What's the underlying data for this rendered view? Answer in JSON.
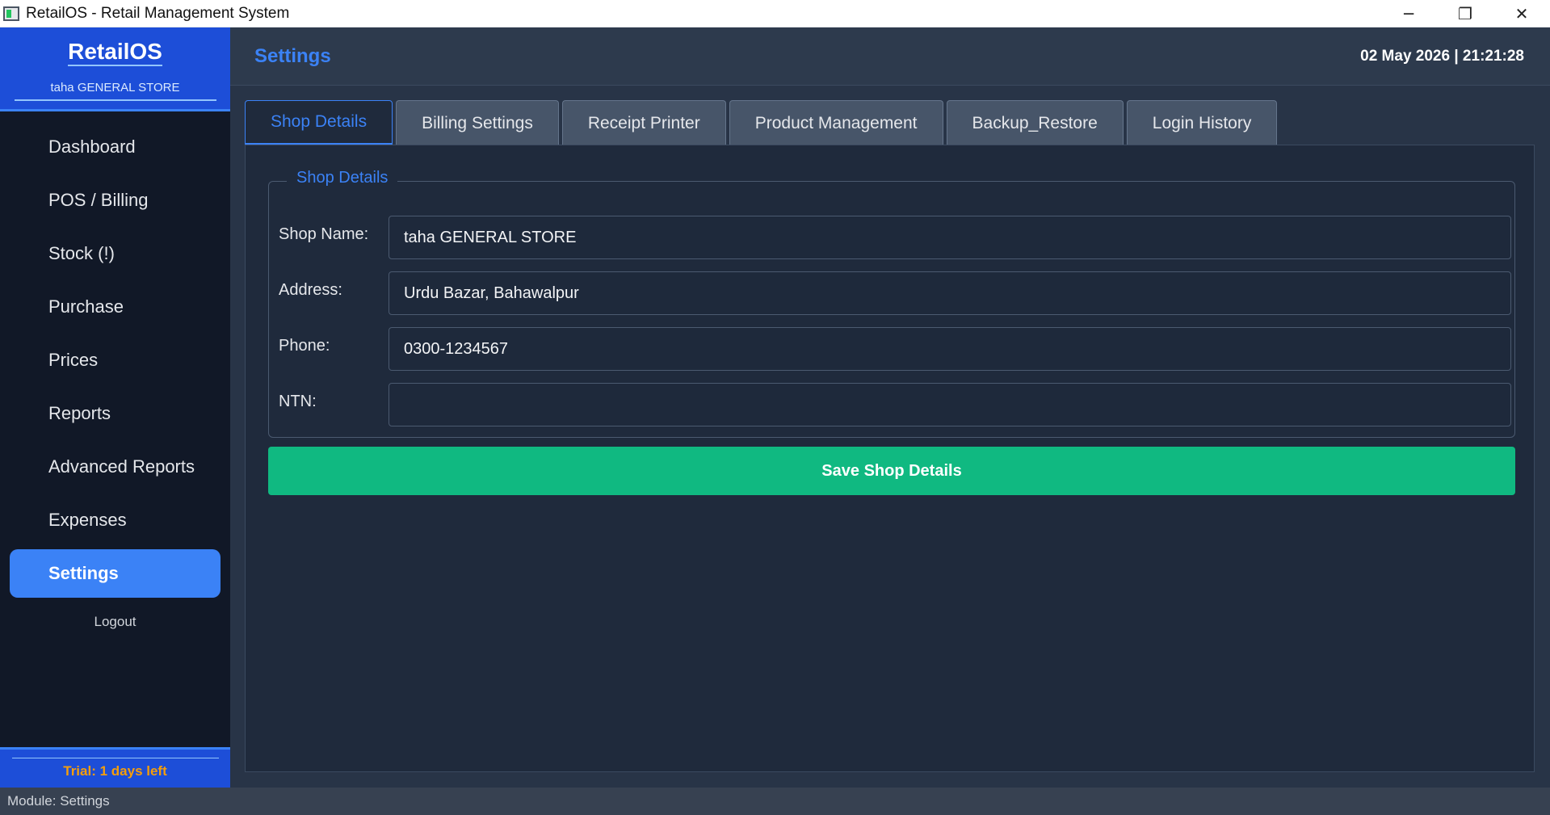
{
  "window": {
    "title": "RetailOS - Retail Management System",
    "minimize_glyph": "─",
    "maximize_glyph": "❐",
    "close_glyph": "✕"
  },
  "sidebar": {
    "brand": "RetailOS",
    "store_name": "taha GENERAL STORE",
    "items": [
      {
        "label": "Dashboard"
      },
      {
        "label": "POS / Billing"
      },
      {
        "label": "Stock (!)"
      },
      {
        "label": "Purchase"
      },
      {
        "label": "Prices"
      },
      {
        "label": "Reports"
      },
      {
        "label": "Advanced Reports"
      },
      {
        "label": "Expenses"
      },
      {
        "label": "Settings"
      }
    ],
    "active_item": "Settings",
    "logout_label": "Logout",
    "trial_text": "Trial: 1 days left"
  },
  "header": {
    "title": "Settings",
    "datetime": "02 May 2026  |  21:21:28"
  },
  "tabs": [
    {
      "label": "Shop Details"
    },
    {
      "label": "Billing Settings"
    },
    {
      "label": "Receipt Printer"
    },
    {
      "label": "Product Management"
    },
    {
      "label": "Backup_Restore"
    },
    {
      "label": "Login History"
    }
  ],
  "shop_details": {
    "group_title": "Shop Details",
    "fields": [
      {
        "label": "Shop Name:",
        "value": "taha GENERAL STORE"
      },
      {
        "label": "Address:",
        "value": "Urdu Bazar, Bahawalpur"
      },
      {
        "label": "Phone:",
        "value": "0300-1234567"
      },
      {
        "label": "NTN:",
        "value": ""
      }
    ],
    "save_label": "Save Shop Details"
  },
  "status_bar": {
    "text": "Module: Settings"
  },
  "colors": {
    "accent": "#3b82f6",
    "brand": "#1d4ed8",
    "save": "#10b981",
    "trial": "#f59e0b"
  }
}
